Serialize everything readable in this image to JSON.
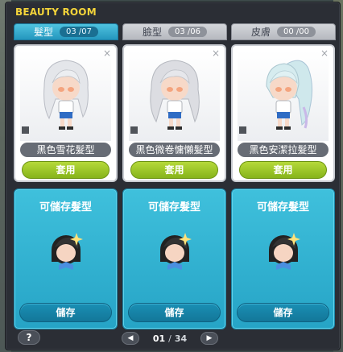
{
  "window": {
    "title": "BEAUTY ROOM"
  },
  "tabs": [
    {
      "label": "髮型",
      "count": "03 /07",
      "active": true
    },
    {
      "label": "臉型",
      "count": "03 /06",
      "active": false
    },
    {
      "label": "皮膚",
      "count": "00 /00",
      "active": false
    }
  ],
  "cards": [
    {
      "name": "黑色雪花髮型",
      "apply_label": "套用",
      "close_glyph": "×",
      "hair_color": "#e4e6ea"
    },
    {
      "name": "黑色微卷慵懶髮型",
      "apply_label": "套用",
      "close_glyph": "×",
      "hair_color": "#dcdde2"
    },
    {
      "name": "黑色安潔拉髮型",
      "apply_label": "套用",
      "close_glyph": "×",
      "hair_color": "#cfe8ec"
    }
  ],
  "slots": [
    {
      "title": "可儲存髮型",
      "save_label": "儲存"
    },
    {
      "title": "可儲存髮型",
      "save_label": "儲存"
    },
    {
      "title": "可儲存髮型",
      "save_label": "儲存"
    }
  ],
  "footer": {
    "help_label": "?",
    "page_current": "01",
    "page_sep": "/",
    "page_total": "34",
    "prev_icon": "chevron-left-icon",
    "next_icon": "chevron-right-icon"
  },
  "colors": {
    "title": "#f5d53a",
    "tab_active": "#2ea8cc",
    "apply": "#9cc52a",
    "slot": "#2fb0d0"
  }
}
